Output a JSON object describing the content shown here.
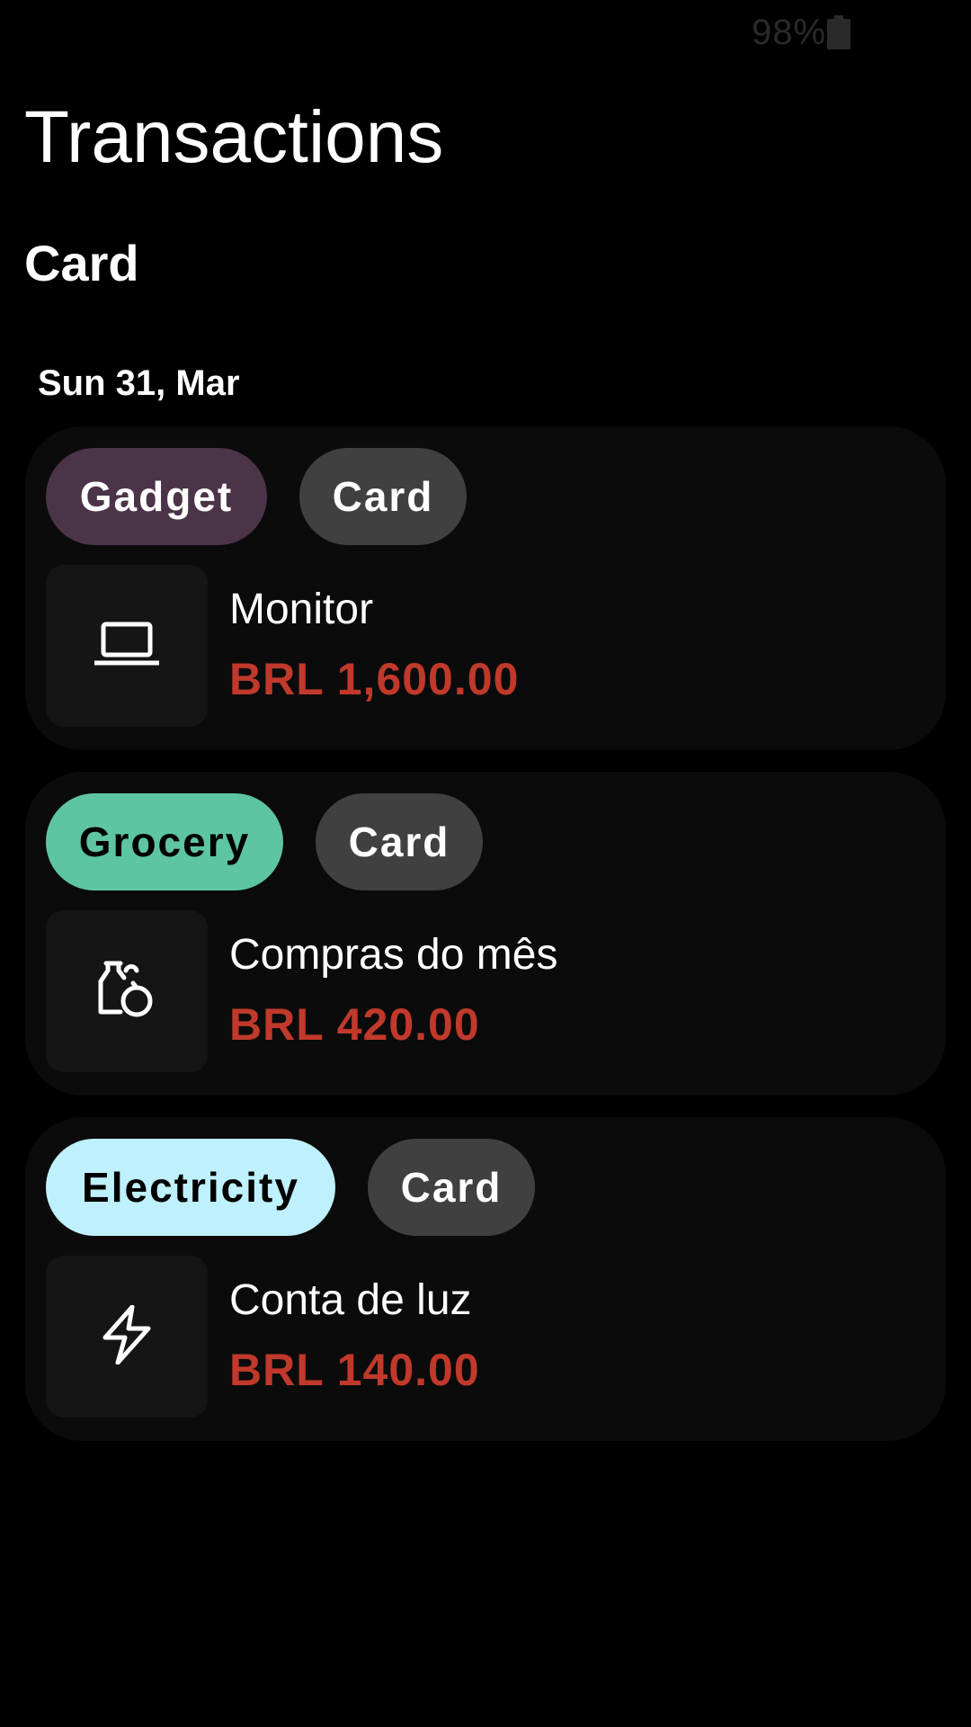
{
  "status_bar": {
    "battery_text": "98%",
    "battery_icon": "battery-icon"
  },
  "header": {
    "title": "Transactions"
  },
  "section": {
    "title": "Card"
  },
  "groups": [
    {
      "date": "Sun 31, Mar",
      "transactions": [
        {
          "category": "Gadget",
          "category_bg": "#4b3448",
          "category_fg": "#ffffff",
          "account": "Card",
          "icon": "laptop-icon",
          "name": "Monitor",
          "amount": "BRL 1,600.00"
        },
        {
          "category": "Grocery",
          "category_bg": "#5ec5a3",
          "category_fg": "#000000",
          "account": "Card",
          "icon": "grocery-icon",
          "name": "Compras do mês",
          "amount": "BRL 420.00"
        },
        {
          "category": "Electricity",
          "category_bg": "#bef1fd",
          "category_fg": "#000000",
          "account": "Card",
          "icon": "lightning-icon",
          "name": "Conta de luz",
          "amount": "BRL 140.00"
        }
      ]
    }
  ],
  "colors": {
    "background": "#000000",
    "card": "#0b0b0b",
    "icon_box": "#151515",
    "account_chip": "#404040",
    "expense_amount": "#c0392b"
  }
}
